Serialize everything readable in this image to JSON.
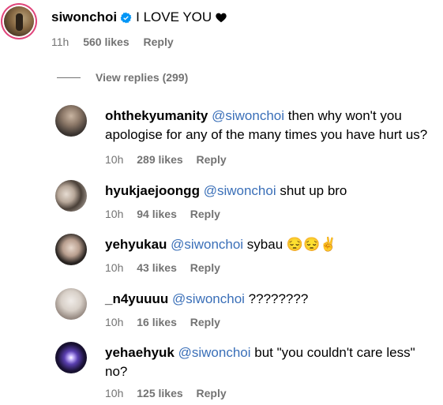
{
  "top_comment": {
    "username": "siwonchoi",
    "text": "I LOVE YOU",
    "time": "11h",
    "likes": "560 likes",
    "reply": "Reply"
  },
  "view_replies": "View replies (299)",
  "replies": [
    {
      "username": "ohthekyumanity",
      "mention": "@siwonchoi",
      "text": " then why won't you apologise for any of the many times you have hurt us?",
      "time": "10h",
      "likes": "289 likes",
      "reply": "Reply"
    },
    {
      "username": "hyukjaejoongg",
      "mention": "@siwonchoi",
      "text": " shut up bro",
      "time": "10h",
      "likes": "94 likes",
      "reply": "Reply"
    },
    {
      "username": "yehyukau",
      "mention": "@siwonchoi",
      "text": " sybau 😔😔✌",
      "time": "10h",
      "likes": "43 likes",
      "reply": "Reply"
    },
    {
      "username": "_n4yuuuu",
      "mention": "@siwonchoi",
      "text": " ????????",
      "time": "10h",
      "likes": "16 likes",
      "reply": "Reply"
    },
    {
      "username": "yehaehyuk",
      "mention": "@siwonchoi",
      "text": " but \"you couldn't care less\" no?",
      "time": "10h",
      "likes": "125 likes",
      "reply": "Reply"
    }
  ],
  "colors": {
    "mention": "#3a6fb8",
    "meta": "#737373",
    "verified": "#0095f6"
  }
}
